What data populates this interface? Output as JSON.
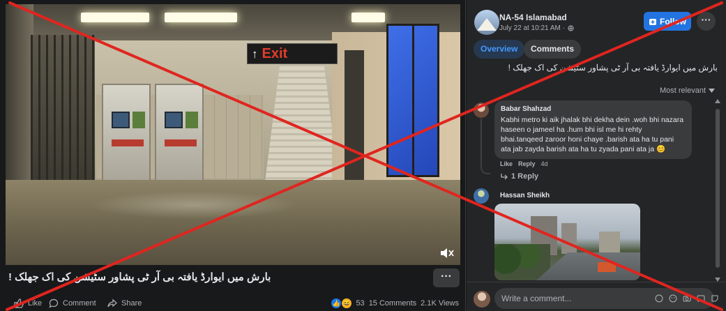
{
  "video": {
    "exit_sign": "Exit",
    "title": "بارش میں ایوارڈ یافتہ بی آر ٹی پشاور سٹیشن کی اک جھلک !",
    "more_label": "···"
  },
  "actions": {
    "like": "Like",
    "comment": "Comment",
    "share": "Share",
    "reaction_count": "53",
    "comments_count": "15 Comments",
    "views": "2.1K Views"
  },
  "post": {
    "page_name": "NA-54 Islamabad",
    "time": "July 22 at 10:21 AM ·",
    "follow_label": "Follow",
    "more_label": "···",
    "tabs": [
      {
        "label": "Overview",
        "active": true
      },
      {
        "label": "Comments",
        "active": false
      }
    ],
    "caption": "بارش میں ایوارڈ یافتہ بی آر ٹی پشاور سٹیشن کی اک جھلک !",
    "sort_label": "Most relevant"
  },
  "comments": [
    {
      "author": "Babar Shahzad",
      "text": "Kabhi metro ki aik jhalak bhi dekha dein .woh bhi nazara haseen o jameel ha .hum bhi isl me hi rehty bhai.tanqeed zaroor honi chaye .barish ata ha tu pani ata jab zayda barish ata ha tu zyada pani ata ja 😊",
      "like": "Like",
      "reply": "Reply",
      "time": "4d",
      "replies_label": "1 Reply"
    },
    {
      "author": "Hassan Sheikh",
      "has_image": true
    }
  ],
  "composer": {
    "placeholder": "Write a comment..."
  },
  "colors": {
    "background": "#18191a",
    "panel": "#242526",
    "accent": "#2374e1",
    "cross": "#e0251f"
  }
}
